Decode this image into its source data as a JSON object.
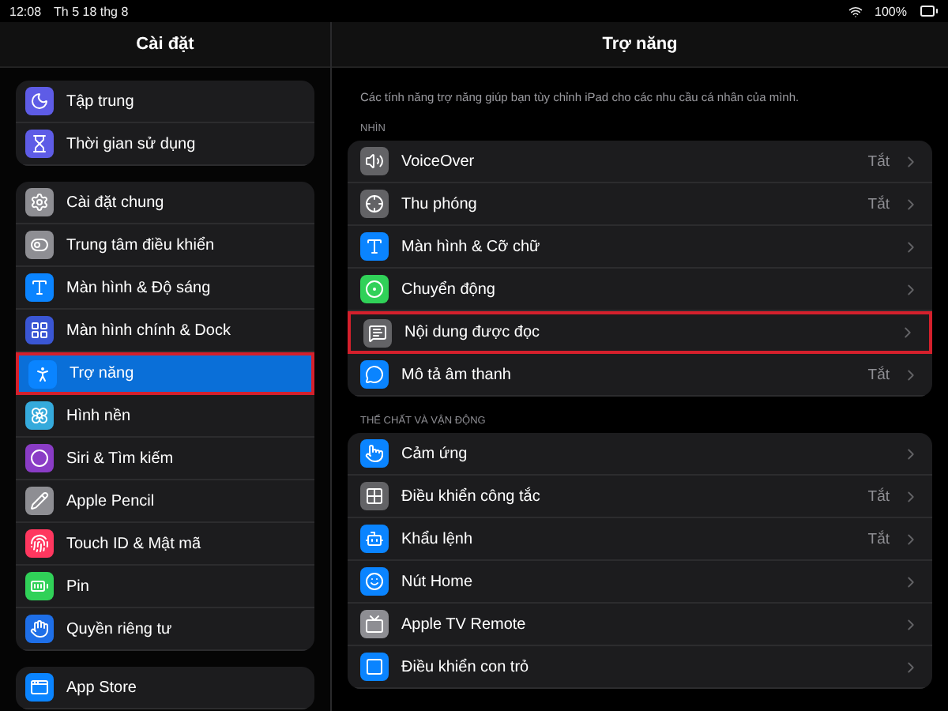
{
  "status_bar": {
    "time": "12:08",
    "date": "Th 5 18 thg 8",
    "battery": "100%"
  },
  "sidebar": {
    "title": "Cài đặt",
    "groups": [
      [
        {
          "label": "Tập trung",
          "color": "#5e5ce6",
          "selected": false,
          "highlighted": false
        },
        {
          "label": "Thời gian sử dụng",
          "color": "#5e5ce6",
          "selected": false,
          "highlighted": false
        }
      ],
      [
        {
          "label": "Cài đặt chung",
          "color": "#8e8e93",
          "selected": false,
          "highlighted": false
        },
        {
          "label": "Trung tâm điều khiển",
          "color": "#8e8e93",
          "selected": false,
          "highlighted": false
        },
        {
          "label": "Màn hình & Độ sáng",
          "color": "#0a84ff",
          "selected": false,
          "highlighted": false
        },
        {
          "label": "Màn hình chính & Dock",
          "color": "#3a56d4",
          "selected": false,
          "highlighted": false
        },
        {
          "label": "Trợ năng",
          "color": "#0a84ff",
          "selected": true,
          "highlighted": true
        },
        {
          "label": "Hình nền",
          "color": "#35aadc",
          "selected": false,
          "highlighted": false
        },
        {
          "label": "Siri & Tìm kiếm",
          "color": "#8a3cc6",
          "selected": false,
          "highlighted": false
        },
        {
          "label": "Apple Pencil",
          "color": "#8e8e93",
          "selected": false,
          "highlighted": false
        },
        {
          "label": "Touch ID & Mật mã",
          "color": "#ff375f",
          "selected": false,
          "highlighted": false
        },
        {
          "label": "Pin",
          "color": "#30d158",
          "selected": false,
          "highlighted": false
        },
        {
          "label": "Quyền riêng tư",
          "color": "#1e6fe8",
          "selected": false,
          "highlighted": false
        }
      ],
      [
        {
          "label": "App Store",
          "color": "#0a84ff",
          "selected": false,
          "highlighted": false
        }
      ]
    ]
  },
  "detail": {
    "title": "Trợ năng",
    "description": "Các tính năng trợ năng giúp bạn tùy chỉnh iPad cho các nhu cầu cá nhân của mình.",
    "sections": [
      {
        "header": "NHÌN",
        "rows": [
          {
            "label": "VoiceOver",
            "value": "Tắt",
            "color": "#636366",
            "highlighted": false
          },
          {
            "label": "Thu phóng",
            "value": "Tắt",
            "color": "#636366",
            "highlighted": false
          },
          {
            "label": "Màn hình & Cỡ chữ",
            "color": "#0a84ff",
            "highlighted": false
          },
          {
            "label": "Chuyển động",
            "color": "#30d158",
            "highlighted": false
          },
          {
            "label": "Nội dung được đọc",
            "color": "#636366",
            "highlighted": true
          },
          {
            "label": "Mô tả âm thanh",
            "value": "Tắt",
            "color": "#0a84ff",
            "highlighted": false
          }
        ]
      },
      {
        "header": "THỂ CHẤT VÀ VẬN ĐỘNG",
        "rows": [
          {
            "label": "Cảm ứng",
            "color": "#0a84ff",
            "highlighted": false
          },
          {
            "label": "Điều khiển công tắc",
            "value": "Tắt",
            "color": "#636366",
            "highlighted": false
          },
          {
            "label": "Khẩu lệnh",
            "value": "Tắt",
            "color": "#0a84ff",
            "highlighted": false
          },
          {
            "label": "Nút Home",
            "color": "#0a84ff",
            "highlighted": false
          },
          {
            "label": "Apple TV Remote",
            "color": "#8e8e93",
            "highlighted": false
          },
          {
            "label": "Điều khiển con trỏ",
            "color": "#0a84ff",
            "highlighted": false
          }
        ]
      }
    ]
  }
}
